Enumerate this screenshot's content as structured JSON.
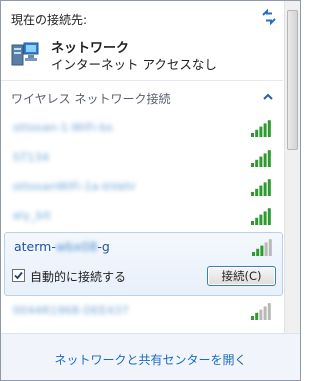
{
  "header": {
    "caption": "現在の接続先:",
    "refresh_icon": "refresh-arrows-icon"
  },
  "connection": {
    "name": "ネットワーク",
    "status": "インターネット アクセスなし",
    "icon": "network-computer-icon"
  },
  "wireless": {
    "section_label": "ワイヤレス ネットワーク接続",
    "collapse_icon": "chevron-up-icon",
    "networks": [
      {
        "name": "ottosan-1-WiFi-bs",
        "signal_bars": 5
      },
      {
        "name": "ST134",
        "signal_bars": 5
      },
      {
        "name": "ottosanWiFi-1a-bVahr",
        "signal_bars": 5
      },
      {
        "name": "aly_bit",
        "signal_bars": 5
      }
    ],
    "expanded": {
      "name_prefix": "aterm-",
      "name_redacted": "wbx08",
      "name_suffix": "-g",
      "signal_bars": 3,
      "auto_connect_label": "自動的に接続する",
      "auto_connect_checked": true,
      "connect_button": "接続(C)"
    },
    "last_network": {
      "name": "0044R1968-DEE437",
      "signal_bars": 2
    }
  },
  "footer": {
    "link": "ネットワークと共有センターを開く"
  },
  "colors": {
    "link": "#1a6bc4",
    "signal_on": "#2e9a2e",
    "signal_off": "#b8b8b8"
  }
}
